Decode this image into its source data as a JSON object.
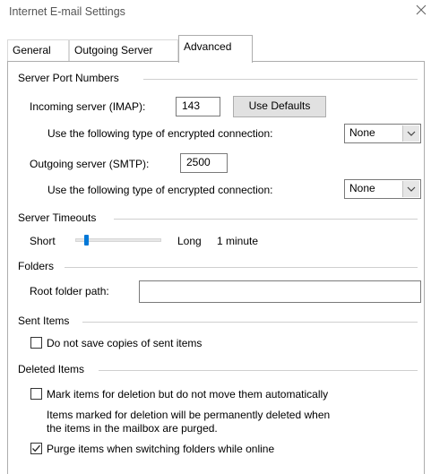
{
  "window": {
    "title": "Internet E-mail Settings",
    "close_icon": "close-icon"
  },
  "tabs": [
    {
      "label": "General",
      "active": false
    },
    {
      "label": "Outgoing Server",
      "active": false
    },
    {
      "label": "Advanced",
      "active": true
    }
  ],
  "server_ports": {
    "group_label": "Server Port Numbers",
    "incoming_label": "Incoming server (IMAP):",
    "incoming_value": "143",
    "use_defaults_label": "Use Defaults",
    "encryption_label_1": "Use the following type of encrypted connection:",
    "encryption_value_1": "None",
    "outgoing_label": "Outgoing server (SMTP):",
    "outgoing_value": "2500",
    "encryption_label_2": "Use the following type of encrypted connection:",
    "encryption_value_2": "None"
  },
  "timeouts": {
    "group_label": "Server Timeouts",
    "short_label": "Short",
    "long_label": "Long",
    "value_label": "1 minute",
    "slider_level": 0.0
  },
  "folders": {
    "group_label": "Folders",
    "root_label": "Root folder path:",
    "root_value": ""
  },
  "sent_items": {
    "group_label": "Sent Items",
    "no_copies_label": "Do not save copies of sent items",
    "no_copies_checked": false
  },
  "deleted_items": {
    "group_label": "Deleted Items",
    "mark_label": "Mark items for deletion but do not move them automatically",
    "mark_checked": false,
    "note_line1": "Items marked for deletion will be permanently deleted when",
    "note_line2": "the items in the mailbox are purged.",
    "purge_label": "Purge items when switching folders while online",
    "purge_checked": true
  }
}
